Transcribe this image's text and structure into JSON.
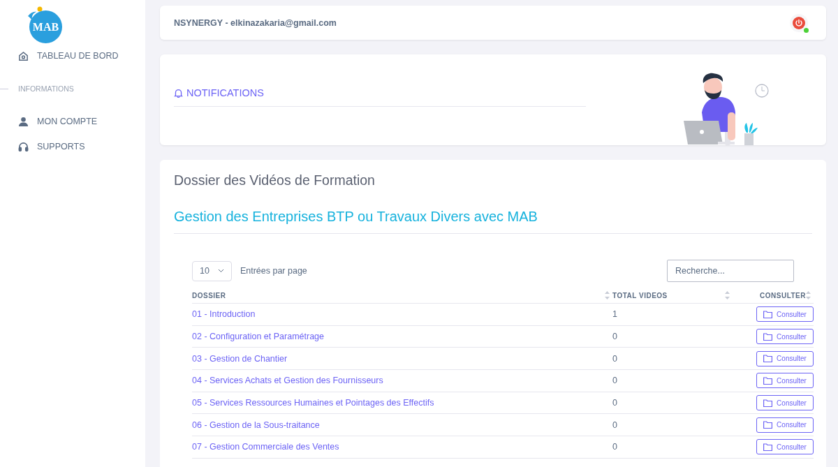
{
  "sidebar": {
    "logo": "MAB",
    "items": [
      {
        "kind": "home",
        "label": "TABLEAU DE BORD"
      },
      {
        "kind": "section",
        "label": "INFORMATIONS"
      },
      {
        "kind": "user",
        "label": "MON COMPTE"
      },
      {
        "kind": "headset",
        "label": "SUPPORTS"
      }
    ]
  },
  "topbar": {
    "user": "NSYNERGY - elkinazakaria@gmail.com",
    "online": true
  },
  "notifications": {
    "title": "NOTIFICATIONS"
  },
  "panel": {
    "title": "Dossier des Vidéos de Formation",
    "subtitle": "Gestion des Entreprises BTP ou Travaux Divers avec MAB",
    "page_size": "10",
    "page_size_label": "Entrées par page",
    "search": {
      "placeholder": "Recherche..."
    },
    "columns": [
      "DOSSIER",
      "TOTAL VIDEOS",
      "CONSULTER"
    ],
    "rows": [
      {
        "dossier": "01 - Introduction",
        "total": "1",
        "action": "Consulter"
      },
      {
        "dossier": "02 - Configuration et Paramétrage",
        "total": "0",
        "action": "Consulter"
      },
      {
        "dossier": "03 - Gestion de Chantier",
        "total": "0",
        "action": "Consulter"
      },
      {
        "dossier": "04 - Services Achats et Gestion des Fournisseurs",
        "total": "0",
        "action": "Consulter"
      },
      {
        "dossier": "05 - Services Ressources Humaines et Pointages des Effectifs",
        "total": "0",
        "action": "Consulter"
      },
      {
        "dossier": "06 - Gestion de la Sous-traitance",
        "total": "0",
        "action": "Consulter"
      },
      {
        "dossier": "07 - Gestion Commerciale des Ventes",
        "total": "0",
        "action": "Consulter"
      }
    ]
  }
}
